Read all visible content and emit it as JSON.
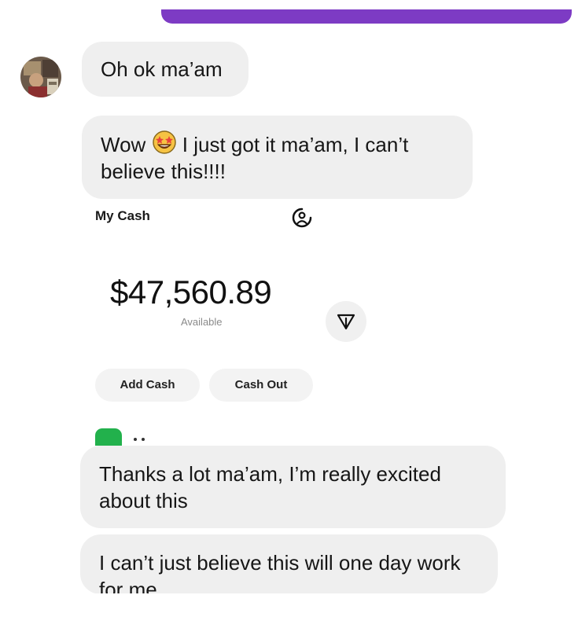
{
  "messages": [
    {
      "text": "Oh ok ma’am"
    },
    {
      "before_emoji": "Wow",
      "emoji": "star-struck-emoji",
      "after_emoji": " I just got it ma’am, I can’t believe this!!!!"
    },
    {
      "text": "Thanks a lot ma’am, I’m really excited about this"
    },
    {
      "text": "I can’t just believe this will one day work for me"
    }
  ],
  "cash_card": {
    "title": "My Cash",
    "balance": "$47,560.89",
    "balance_caption": "Available",
    "add_cash_label": "Add Cash",
    "cash_out_label": "Cash Out",
    "accent_color": "#22b14c"
  },
  "icons": {
    "avatar": "avatar",
    "profile": "profile-icon",
    "send": "send-icon"
  },
  "colors": {
    "top_bar": "#7d3bc4",
    "bubble": "#efefef"
  }
}
